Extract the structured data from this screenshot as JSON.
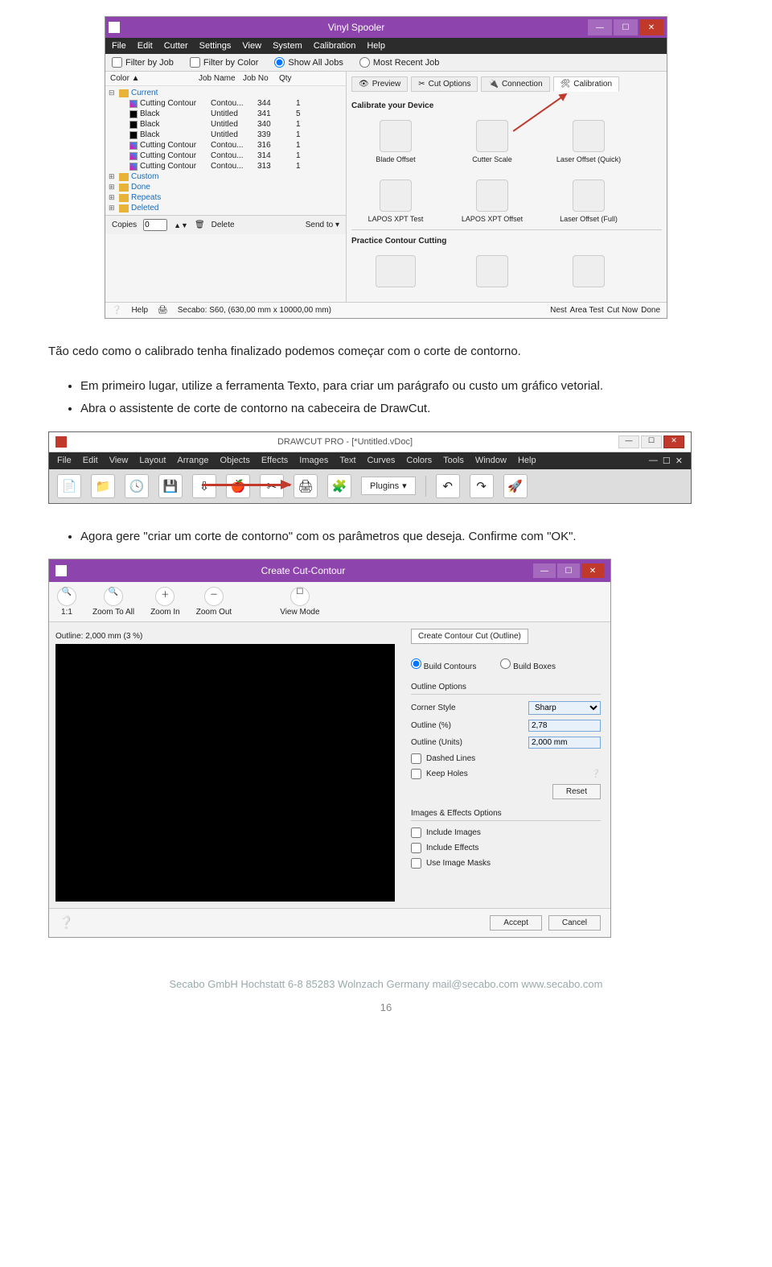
{
  "vinyl_spooler": {
    "title": "Vinyl Spooler",
    "menubar": [
      "File",
      "Edit",
      "Cutter",
      "Settings",
      "View",
      "System",
      "Calibration",
      "Help"
    ],
    "filterbar": {
      "filter_job": "Filter by Job",
      "filter_color": "Filter by Color",
      "show_all": "Show All Jobs",
      "most_recent": "Most Recent Job"
    },
    "table_headers": {
      "color": "Color ▲",
      "job": "Job Name",
      "jobno": "Job No",
      "qty": "Qty"
    },
    "tree": {
      "folders": [
        {
          "name": "Current",
          "expanded": true,
          "items": [
            {
              "color": "Cutting Contour",
              "job": "Contou...",
              "jobno": "344",
              "qty": "1",
              "type": "contour"
            },
            {
              "color": "Black",
              "job": "Untitled",
              "jobno": "341",
              "qty": "5",
              "type": "black"
            },
            {
              "color": "Black",
              "job": "Untitled",
              "jobno": "340",
              "qty": "1",
              "type": "black"
            },
            {
              "color": "Black",
              "job": "Untitled",
              "jobno": "339",
              "qty": "1",
              "type": "black"
            },
            {
              "color": "Cutting Contour",
              "job": "Contou...",
              "jobno": "316",
              "qty": "1",
              "type": "contour"
            },
            {
              "color": "Cutting Contour",
              "job": "Contou...",
              "jobno": "314",
              "qty": "1",
              "type": "contour"
            },
            {
              "color": "Cutting Contour",
              "job": "Contou...",
              "jobno": "313",
              "qty": "1",
              "type": "contour"
            }
          ]
        },
        {
          "name": "Custom"
        },
        {
          "name": "Done"
        },
        {
          "name": "Repeats"
        },
        {
          "name": "Deleted"
        }
      ]
    },
    "copies": {
      "label": "Copies",
      "value": "0",
      "delete": "Delete",
      "send": "Send to ▾"
    },
    "right_tabs": [
      "Preview",
      "Cut Options",
      "Connection",
      "Calibration"
    ],
    "active_tab_idx": 3,
    "section1": "Calibrate your Device",
    "calib_icons": [
      "Blade Offset",
      "Cutter Scale",
      "Laser Offset (Quick)",
      "LAPOS XPT Test",
      "LAPOS XPT Offset",
      "Laser Offset (Full)"
    ],
    "section2": "Practice Contour Cutting",
    "footer_buttons": [
      "Nest",
      "Area Test",
      "Cut Now",
      "Done"
    ],
    "status": {
      "help": "Help",
      "device": "Secabo: S60, (630,00 mm x 10000,00 mm)"
    }
  },
  "doc": {
    "p1": "Tão cedo como o calibrado tenha finalizado podemos começar com o corte de contorno.",
    "b1": "Em primeiro lugar, utilize a ferramenta Texto, para criar um parágrafo ou custo um gráfico vetorial.",
    "b2": "Abra o assistente de corte de contorno na cabeceira de DrawCut.",
    "b3": "Agora gere \"criar um corte de contorno\" com os parâmetros que deseja. Confirme com \"OK\"."
  },
  "drawcut": {
    "title": "DRAWCUT PRO - [*Untitled.vDoc]",
    "menubar": [
      "File",
      "Edit",
      "View",
      "Layout",
      "Arrange",
      "Objects",
      "Effects",
      "Images",
      "Text",
      "Curves",
      "Colors",
      "Tools",
      "Window",
      "Help"
    ],
    "plugins": "Plugins"
  },
  "cut_contour": {
    "title": "Create Cut-Contour",
    "zoom": [
      "1:1",
      "Zoom To All",
      "Zoom In",
      "Zoom Out",
      "View Mode"
    ],
    "outline_label": "Outline: 2,000 mm (3 %)",
    "tab": "Create Contour Cut (Outline)",
    "radio1": "Build Contours",
    "radio2": "Build Boxes",
    "group1": "Outline Options",
    "corner_style": {
      "label": "Corner Style",
      "value": "Sharp"
    },
    "outline_pct": {
      "label": "Outline (%)",
      "value": "2,78"
    },
    "outline_units": {
      "label": "Outline (Units)",
      "value": "2,000 mm"
    },
    "dashed": "Dashed Lines",
    "keep_holes": "Keep Holes",
    "reset": "Reset",
    "group2": "Images & Effects Options",
    "inc_images": "Include Images",
    "inc_effects": "Include Effects",
    "use_masks": "Use Image Masks",
    "accept": "Accept",
    "cancel": "Cancel"
  },
  "footer": {
    "line": "Secabo GmbH   Hochstatt 6-8   85283 Wolnzach   Germany   mail@secabo.com   www.secabo.com",
    "page": "16"
  }
}
